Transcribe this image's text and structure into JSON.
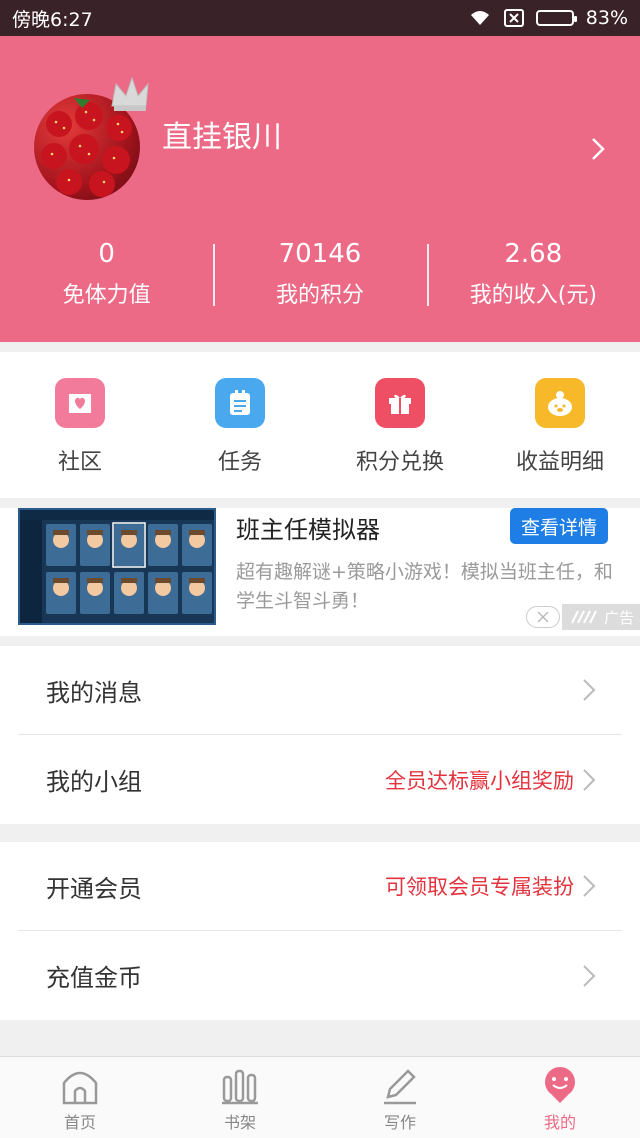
{
  "status_bar": {
    "time": "傍晚6:27",
    "battery": "83%",
    "battery_level": 0.83
  },
  "profile": {
    "username": "直挂银川"
  },
  "stats": [
    {
      "value": "0",
      "label": "免体力值"
    },
    {
      "value": "70146",
      "label": "我的积分"
    },
    {
      "value": "2.68",
      "label": "我的收入(元)"
    }
  ],
  "actions": [
    {
      "label": "社区",
      "icon": "heart-envelope-icon",
      "color": "#f27a9a"
    },
    {
      "label": "任务",
      "icon": "clipboard-icon",
      "color": "#4aa8ee"
    },
    {
      "label": "积分兑换",
      "icon": "gift-icon",
      "color": "#ef4f64"
    },
    {
      "label": "收益明细",
      "icon": "piggy-bank-icon",
      "color": "#f7b82a"
    }
  ],
  "ad": {
    "title": "班主任模拟器",
    "button": "查看详情",
    "description": "超有趣解谜+策略小游戏！模拟当班主任，和学生斗智斗勇！",
    "tag": "广告"
  },
  "menu_group1": [
    {
      "label": "我的消息",
      "promo": ""
    },
    {
      "label": "我的小组",
      "promo": "全员达标赢小组奖励"
    }
  ],
  "menu_group2": [
    {
      "label": "开通会员",
      "promo": "可领取会员专属装扮"
    },
    {
      "label": "充值金币",
      "promo": ""
    }
  ],
  "tabs": [
    {
      "label": "首页",
      "icon": "home-icon"
    },
    {
      "label": "书架",
      "icon": "bookshelf-icon"
    },
    {
      "label": "写作",
      "icon": "pencil-icon"
    },
    {
      "label": "我的",
      "icon": "profile-icon",
      "active": true
    }
  ],
  "colors": {
    "accent": "#ec6a86",
    "promo": "#e2333e",
    "ad_button": "#1e7ee6"
  }
}
